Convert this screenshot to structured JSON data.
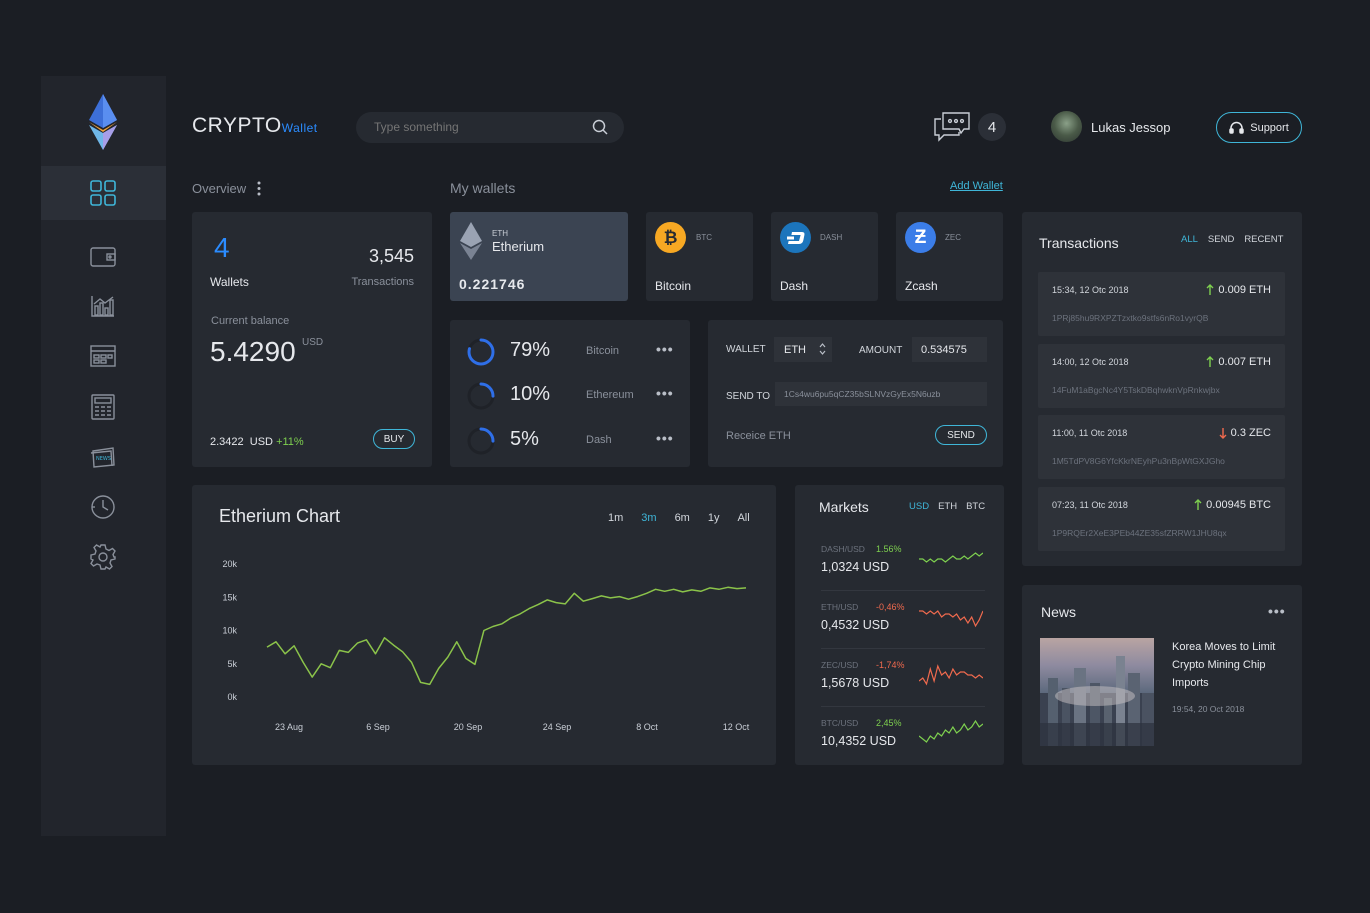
{
  "header": {
    "brand_main": "CRYPTO",
    "brand_sub": "Wallet",
    "search_placeholder": "Type something",
    "messages_count": "4",
    "user_name": "Lukas Jessop",
    "support_label": "Support"
  },
  "overview": {
    "title": "Overview",
    "wallets_count": "4",
    "wallets_label": "Wallets",
    "transactions_count": "3,545",
    "transactions_label": "Transactions",
    "balance_label": "Current balance",
    "balance_value": "5.4290",
    "balance_unit": "USD",
    "sub_value": "2.3422",
    "sub_unit": "USD",
    "sub_change": "+11%",
    "buy_label": "BUY"
  },
  "wallets": {
    "title": "My wallets",
    "add_label": "Add Wallet",
    "items": [
      {
        "ticker": "ETH",
        "name": "Etherium",
        "value": "0.221746"
      },
      {
        "ticker": "BTC",
        "name": "Bitcoin"
      },
      {
        "ticker": "DASH",
        "name": "Dash"
      },
      {
        "ticker": "ZEC",
        "name": "Zcash"
      }
    ]
  },
  "allocation": [
    {
      "percent": "79%",
      "name": "Bitcoin",
      "fraction": 0.79
    },
    {
      "percent": "10%",
      "name": "Ethereum",
      "fraction": 0.1
    },
    {
      "percent": "5%",
      "name": "Dash",
      "fraction": 0.05
    }
  ],
  "send": {
    "wallet_label": "WALLET",
    "wallet_value": "ETH",
    "amount_label": "AMOUNT",
    "amount_value": "0.534575",
    "send_to_label": "SEND TO",
    "send_to_value": "1Cs4wu6pu5qCZ35bSLNVzGyEx5N6uzb",
    "receive_label": "Receice ETH",
    "send_button": "SEND"
  },
  "chart_data": {
    "type": "line",
    "title": "Etherium Chart",
    "ranges": [
      "1m",
      "3m",
      "6m",
      "1y",
      "All"
    ],
    "active_range": "3m",
    "x_labels": [
      "23 Aug",
      "6 Sep",
      "20 Sep",
      "24 Sep",
      "8 Oct",
      "12 Oct"
    ],
    "y_labels": [
      "20k",
      "15k",
      "10k",
      "5k",
      "0k"
    ],
    "ylim": [
      0,
      20000
    ],
    "values": [
      7500,
      8300,
      6500,
      7700,
      5200,
      3000,
      5000,
      4400,
      7000,
      6700,
      8100,
      8600,
      6500,
      8900,
      7800,
      6800,
      5200,
      2200,
      1900,
      4300,
      6000,
      8300,
      5800,
      4900,
      10000,
      10600,
      11000,
      11900,
      12500,
      13300,
      13900,
      14600,
      14200,
      14000,
      15600,
      14400,
      14800,
      15200,
      14900,
      15100,
      14700,
      15100,
      15600,
      16200,
      15900,
      16200,
      15800,
      16100,
      15900,
      16400,
      16200,
      16500,
      16300,
      16400
    ],
    "color": "#8bc34a"
  },
  "markets": {
    "title": "Markets",
    "tabs": [
      "USD",
      "ETH",
      "BTC"
    ],
    "items": [
      {
        "pair": "DASH/USD",
        "change": "1.56%",
        "value": "1,0324",
        "unit": "USD",
        "trend": "up",
        "spark": [
          4,
          4,
          3,
          4,
          3,
          4,
          4,
          3,
          4,
          5,
          4,
          4,
          5,
          4,
          5,
          6,
          5,
          6
        ]
      },
      {
        "pair": "ETH/USD",
        "change": "-0,46%",
        "value": "0,4532",
        "unit": "USD",
        "trend": "down",
        "spark": [
          6,
          6,
          5,
          6,
          5,
          6,
          4,
          5,
          5,
          4,
          5,
          3,
          4,
          2,
          4,
          1,
          3,
          6
        ]
      },
      {
        "pair": "ZEC/USD",
        "change": "-1,74%",
        "value": "1,5678",
        "unit": "USD",
        "trend": "down",
        "spark": [
          2,
          3,
          1,
          6,
          2,
          7,
          4,
          5,
          3,
          6,
          4,
          5,
          5,
          4,
          4,
          3,
          4,
          3
        ]
      },
      {
        "pair": "BTC/USD",
        "change": "2,45%",
        "value": "10,4352",
        "unit": "USD",
        "trend": "up",
        "spark": [
          3,
          2,
          1,
          3,
          2,
          4,
          3,
          5,
          4,
          6,
          4,
          5,
          7,
          5,
          6,
          8,
          6,
          7
        ]
      }
    ]
  },
  "transactions": {
    "title": "Transactions",
    "tabs": [
      "ALL",
      "SEND",
      "RECENT"
    ],
    "items": [
      {
        "time": "15:34, 12 Otc 2018",
        "amount": "0.009 ETH",
        "dir": "up",
        "hash": "1PRj85hu9RXPZTzxtko9stfs6nRo1vyrQB"
      },
      {
        "time": "14:00, 12 Otc 2018",
        "amount": "0.007 ETH",
        "dir": "up",
        "hash": "14FuM1aBgcNc4Y5TskDBqhwknVpRnkwjbx"
      },
      {
        "time": "11:00, 11 Otc 2018",
        "amount": "0.3 ZEC",
        "dir": "down",
        "hash": "1M5TdPV8G6YfcKkrNEyhPu3nBpWtGXJGho"
      },
      {
        "time": "07:23, 11 Otc 2018",
        "amount": "0.00945 BTC",
        "dir": "up",
        "hash": "1P9RQEr2XeE3PEb44ZE35sfZRRW1JHU8qx"
      }
    ]
  },
  "news": {
    "title": "News",
    "headline": "Korea Moves to Limit Crypto Mining Chip Imports",
    "time": "19:54, 20 Oct 2018"
  },
  "colors": {
    "accent": "#2b8cff",
    "cyan": "#3fb6d8",
    "positive": "#7ed04f",
    "negative": "#f06a4e"
  }
}
